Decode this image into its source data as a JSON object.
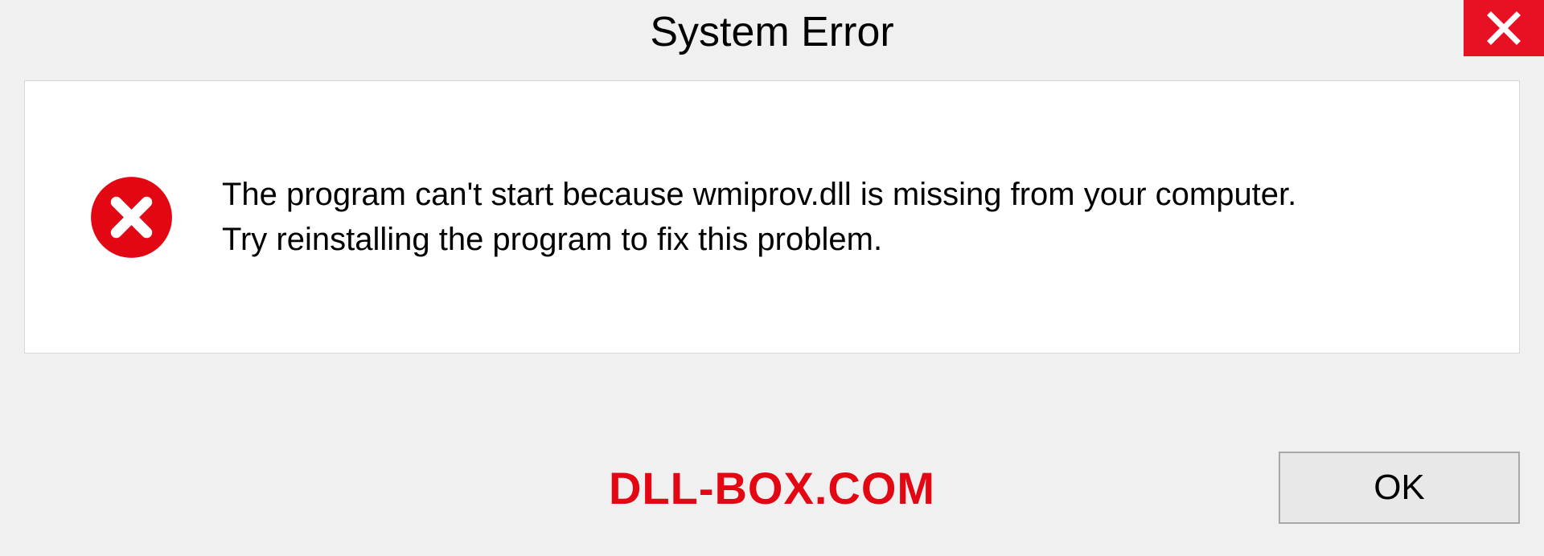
{
  "titlebar": {
    "title": "System Error"
  },
  "message": {
    "text": "The program can't start because wmiprov.dll is missing from your computer. Try reinstalling the program to fix this problem."
  },
  "footer": {
    "watermark": "DLL-BOX.COM",
    "ok_label": "OK"
  },
  "icons": {
    "close": "close-icon",
    "error": "error-circle-x-icon"
  },
  "colors": {
    "close_bg": "#e81123",
    "error_icon": "#e30613",
    "watermark": "#e30613",
    "panel_bg": "#ffffff",
    "window_bg": "#f0f0f0"
  }
}
